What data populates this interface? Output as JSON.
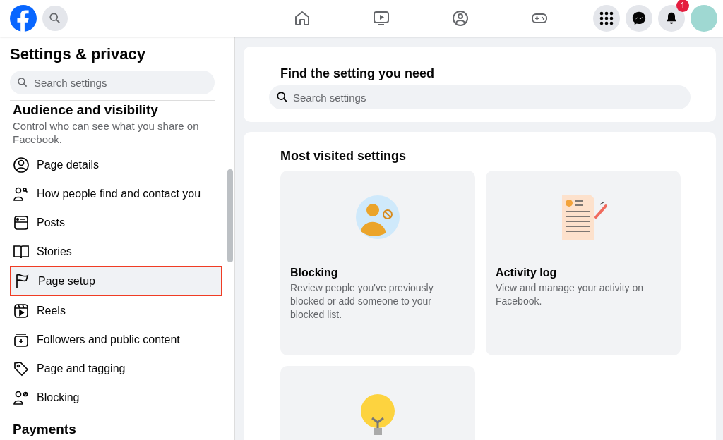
{
  "topbar": {
    "nav": [
      {
        "kind": "home"
      },
      {
        "kind": "video"
      },
      {
        "kind": "groups"
      },
      {
        "kind": "gaming"
      }
    ],
    "actions": [
      {
        "kind": "menu"
      },
      {
        "kind": "messenger"
      },
      {
        "kind": "bell",
        "badge": "1"
      }
    ]
  },
  "sidebar": {
    "title": "Settings & privacy",
    "search": {
      "placeholder": "Search settings"
    },
    "section": {
      "title": "Audience and visibility",
      "description": "Control who can see what you share on Facebook."
    },
    "items": [
      {
        "label": "Page details",
        "kind": "profile",
        "highlighted": false
      },
      {
        "label": "How people find and contact you",
        "kind": "discovery",
        "highlighted": false
      },
      {
        "label": "Posts",
        "kind": "posts",
        "highlighted": false
      },
      {
        "label": "Stories",
        "kind": "stories",
        "highlighted": false
      },
      {
        "label": "Page setup",
        "kind": "setup",
        "highlighted": true
      },
      {
        "label": "Reels",
        "kind": "reels",
        "highlighted": false
      },
      {
        "label": "Followers and public content",
        "kind": "followers",
        "highlighted": false
      },
      {
        "label": "Page and tagging",
        "kind": "tagging",
        "highlighted": false
      },
      {
        "label": "Blocking",
        "kind": "blocking",
        "highlighted": false
      }
    ],
    "next_section": "Payments"
  },
  "main": {
    "search_card": {
      "title": "Find the setting you need",
      "search": {
        "placeholder": "Search settings"
      }
    },
    "most_visited": {
      "title": "Most visited settings",
      "cards": [
        {
          "kind": "blocking",
          "title": "Blocking",
          "description": "Review people you've previously blocked or add someone to your blocked list."
        },
        {
          "kind": "activity",
          "title": "Activity log",
          "description": "View and manage your activity on Facebook."
        },
        {
          "kind": "bulb"
        }
      ]
    }
  }
}
